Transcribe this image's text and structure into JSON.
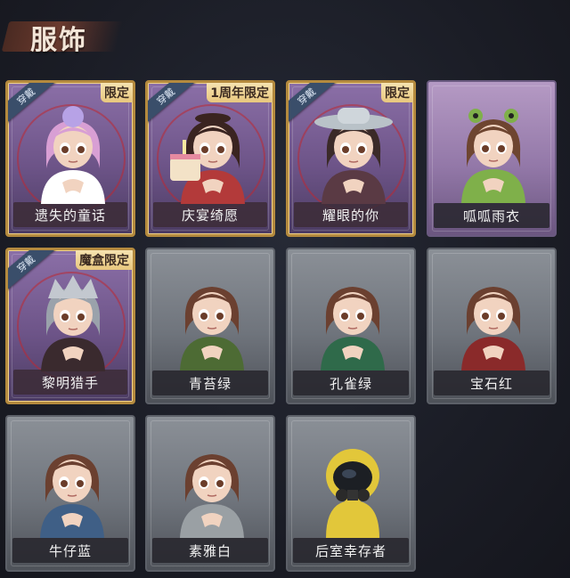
{
  "header": {
    "title": "服饰"
  },
  "badges": {
    "wear": "穿戴"
  },
  "outfits": [
    {
      "name": "遗失的童话",
      "limit": "限定",
      "worn": true,
      "frame": "gold",
      "icon": "pink-hair-character-icon",
      "hair": "#d89fd4",
      "cloth": "#ffffff"
    },
    {
      "name": "庆宴绮愿",
      "limit": "1周年限定",
      "worn": true,
      "frame": "gold",
      "icon": "birthday-cake-character-icon",
      "hair": "#3a2420",
      "cloth": "#b33a3a"
    },
    {
      "name": "耀眼的你",
      "limit": "限定",
      "worn": true,
      "frame": "gold",
      "icon": "cowboy-hat-character-icon",
      "hair": "#3b2a28",
      "cloth": "#5a3a44"
    },
    {
      "name": "呱呱雨衣",
      "limit": "",
      "worn": false,
      "frame": "purple",
      "icon": "frog-hat-character-icon",
      "hair": "#6e4530",
      "cloth": "#7fb04a"
    },
    {
      "name": "黎明猎手",
      "limit": "魔盒限定",
      "worn": true,
      "frame": "gold",
      "icon": "silver-hair-hunter-icon",
      "hair": "#9aa2ab",
      "cloth": "#3a2a2e"
    },
    {
      "name": "青苔绿",
      "limit": "",
      "worn": false,
      "frame": "gray",
      "icon": "girl-moss-green-icon",
      "hair": "#6b4030",
      "cloth": "#4d6b34"
    },
    {
      "name": "孔雀绿",
      "limit": "",
      "worn": false,
      "frame": "gray",
      "icon": "girl-peacock-green-icon",
      "hair": "#6b4030",
      "cloth": "#2f6a4a"
    },
    {
      "name": "宝石红",
      "limit": "",
      "worn": false,
      "frame": "gray",
      "icon": "girl-ruby-red-icon",
      "hair": "#6b4030",
      "cloth": "#8a2a2a"
    },
    {
      "name": "牛仔蓝",
      "limit": "",
      "worn": false,
      "frame": "gray",
      "icon": "girl-denim-blue-icon",
      "hair": "#6b4030",
      "cloth": "#3f5f86"
    },
    {
      "name": "素雅白",
      "limit": "",
      "worn": false,
      "frame": "gray",
      "icon": "girl-plain-white-icon",
      "hair": "#6b4030",
      "cloth": "#9aa0a4"
    },
    {
      "name": "后室幸存者",
      "limit": "",
      "worn": false,
      "frame": "gray",
      "icon": "gas-mask-survivor-icon",
      "hair": "#e2c73a",
      "cloth": "#e2c73a"
    }
  ]
}
